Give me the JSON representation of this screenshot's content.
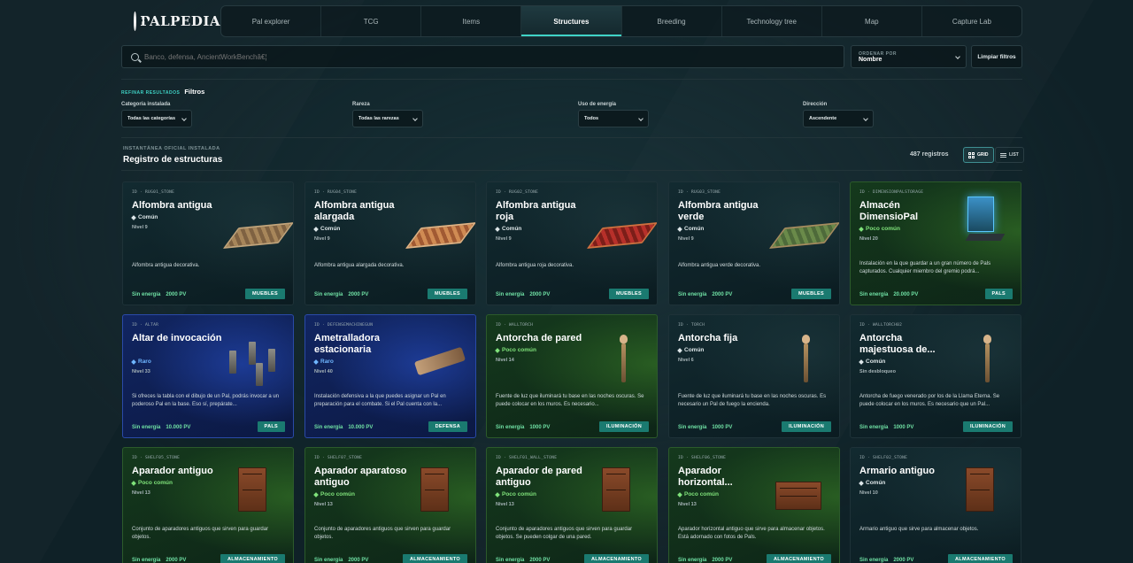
{
  "app": {
    "logo_text": "PALPEDIA"
  },
  "nav": {
    "tabs": [
      {
        "label": "Pal explorer"
      },
      {
        "label": "TCG"
      },
      {
        "label": "Items"
      },
      {
        "label": "Structures",
        "active": true
      },
      {
        "label": "Breeding"
      },
      {
        "label": "Technology tree"
      },
      {
        "label": "Map"
      },
      {
        "label": "Capture Lab"
      }
    ]
  },
  "search": {
    "placeholder": "Banco, defensa, AncientWorkBenchâ€¦",
    "value": "Banco, defensa, AncientWorkBenchâ€¦"
  },
  "sort": {
    "label": "ORDENAR POR",
    "value": "Nombre"
  },
  "clear_filters_label": "Limpiar filtros",
  "refine": {
    "label": "REFINAR RESULTADOS",
    "title": "Filtros"
  },
  "filters": [
    {
      "label": "Categoría instalada",
      "value": "Todas las categorías"
    },
    {
      "label": "Rareza",
      "value": "Todas las rarezas"
    },
    {
      "label": "Uso de energía",
      "value": "Todos"
    },
    {
      "label": "Dirección",
      "value": "Ascendente"
    }
  ],
  "registry": {
    "subtitle": "INSTANTÁNEA OFICIAL INSTALADA",
    "title": "Registro de estructuras",
    "count": "487 registros",
    "view_grid_label": "GRID",
    "view_list_label": "LIST"
  },
  "cards": [
    {
      "id": "ID · RUG01_STONE",
      "name": "Alfombra antigua",
      "rarity": "Común",
      "rarity_class": "comun",
      "level": "Nivel 9",
      "desc": "Alfombra antigua decorativa.",
      "energy": "Sin energía",
      "pv": "2000 PV",
      "tag": "MUEBLES",
      "tint": "dark",
      "art": "rug c1"
    },
    {
      "id": "ID · RUG04_STONE",
      "name": "Alfombra antigua alargada",
      "rarity": "Común",
      "rarity_class": "comun",
      "level": "Nivel 9",
      "desc": "Alfombra antigua alargada decorativa.",
      "energy": "Sin energía",
      "pv": "2000 PV",
      "tag": "MUEBLES",
      "tint": "dark",
      "art": "rug c2"
    },
    {
      "id": "ID · RUG02_STONE",
      "name": "Alfombra antigua roja",
      "rarity": "Común",
      "rarity_class": "comun",
      "level": "Nivel 9",
      "desc": "Alfombra antigua roja decorativa.",
      "energy": "Sin energía",
      "pv": "2000 PV",
      "tag": "MUEBLES",
      "tint": "dark",
      "art": "rug c3"
    },
    {
      "id": "ID · RUG03_STONE",
      "name": "Alfombra antigua verde",
      "rarity": "Común",
      "rarity_class": "comun",
      "level": "Nivel 9",
      "desc": "Alfombra antigua verde decorativa.",
      "energy": "Sin energía",
      "pv": "2000 PV",
      "tag": "MUEBLES",
      "tint": "dark",
      "art": "rug c4"
    },
    {
      "id": "ID · DIMENSIONPALSTORAGE",
      "name": "Almacén DimensioPal",
      "rarity": "Poco común",
      "rarity_class": "poco",
      "level": "Nivel 20",
      "desc": "Instalación en la que guardar a un gran número de Pals capturados. Cualquier miembro del gremio podrá...",
      "energy": "Sin energía",
      "pv": "20.000 PV",
      "tag": "PALS",
      "tint": "green",
      "art": "storage"
    },
    {
      "id": "ID · ALTAR",
      "name": "Altar de invocación",
      "rarity": "Raro",
      "rarity_class": "raro",
      "level": "Nivel 33",
      "desc": "Si ofreces la tabla con el dibujo de un Pal, podrás invocar a un poderoso Pal en la base. Eso sí, prepárate...",
      "energy": "Sin energía",
      "pv": "10.000 PV",
      "tag": "PALS",
      "tint": "blue",
      "art": "altar"
    },
    {
      "id": "ID · DEFENSEMACHINEGUN",
      "name": "Ametralladora estacionaria",
      "rarity": "Raro",
      "rarity_class": "raro",
      "level": "Nivel 40",
      "desc": "Instalación defensiva a la que puedes asignar un Pal en preparación para el combate. Si el Pal cuenta con la...",
      "energy": "Sin energía",
      "pv": "10.000 PV",
      "tag": "DEFENSA",
      "tint": "blue",
      "art": "gun"
    },
    {
      "id": "ID · WALLTORCH",
      "name": "Antorcha de pared",
      "rarity": "Poco común",
      "rarity_class": "poco",
      "level": "Nivel 14",
      "desc": "Fuente de luz que iluminará tu base en las noches oscuras. Se puede colocar en los muros. Es necesario...",
      "energy": "Sin energía",
      "pv": "1000 PV",
      "tag": "ILUMINACIÓN",
      "tint": "green",
      "art": "torch"
    },
    {
      "id": "ID · TORCH",
      "name": "Antorcha fija",
      "rarity": "Común",
      "rarity_class": "comun",
      "level": "Nivel 6",
      "desc": "Fuente de luz que iluminará tu base en las noches oscuras. Es necesario un Pal de fuego la encienda.",
      "energy": "Sin energía",
      "pv": "1000 PV",
      "tag": "ILUMINACIÓN",
      "tint": "dark",
      "art": "torch"
    },
    {
      "id": "ID · WALLTORCH02",
      "name": "Antorcha majestuosa de...",
      "rarity": "Común",
      "rarity_class": "comun",
      "level": "Sin desbloqueo",
      "desc": "Antorcha de fuego venerado por los de la Llama Eterna. Se puede colocar en los muros. Es necesario que un Pal...",
      "energy": "Sin energía",
      "pv": "1000 PV",
      "tag": "ILUMINACIÓN",
      "tint": "dark",
      "art": "torch"
    },
    {
      "id": "ID · SHELF05_STONE",
      "name": "Aparador antiguo",
      "rarity": "Poco común",
      "rarity_class": "poco",
      "level": "Nivel 13",
      "desc": "Conjunto de aparadores antiguos que sirven para guardar objetos.",
      "energy": "Sin energía",
      "pv": "2000 PV",
      "tag": "ALMACENAMIENTO",
      "tint": "green",
      "art": "cabinet"
    },
    {
      "id": "ID · SHELF07_STONE",
      "name": "Aparador aparatoso antiguo",
      "rarity": "Poco común",
      "rarity_class": "poco",
      "level": "Nivel 13",
      "desc": "Conjunto de aparadores antiguos que sirven para guardar objetos.",
      "energy": "Sin energía",
      "pv": "2000 PV",
      "tag": "ALMACENAMIENTO",
      "tint": "green",
      "art": "cabinet"
    },
    {
      "id": "ID · SHELF01_WALL_STONE",
      "name": "Aparador de pared antiguo",
      "rarity": "Poco común",
      "rarity_class": "poco",
      "level": "Nivel 13",
      "desc": "Conjunto de aparadores antiguos que sirven para guardar objetos. Se pueden colgar de una pared.",
      "energy": "Sin energía",
      "pv": "2000 PV",
      "tag": "ALMACENAMIENTO",
      "tint": "green",
      "art": "cabinet"
    },
    {
      "id": "ID · SHELF06_STONE",
      "name": "Aparador horizontal...",
      "rarity": "Poco común",
      "rarity_class": "poco",
      "level": "Nivel 13",
      "desc": "Aparador horizontal antiguo que sirve para almacenar objetos. Está adornado con fotos de Pals.",
      "energy": "Sin energía",
      "pv": "2000 PV",
      "tag": "ALMACENAMIENTO",
      "tint": "green",
      "art": "cabinet wide"
    },
    {
      "id": "ID · SHELF02_STONE",
      "name": "Armario antiguo",
      "rarity": "Común",
      "rarity_class": "comun",
      "level": "Nivel 10",
      "desc": "Armario antiguo que sirve para almacenar objetos.",
      "energy": "Sin energía",
      "pv": "2000 PV",
      "tag": "ALMACENAMIENTO",
      "tint": "dark",
      "art": "cabinet"
    }
  ]
}
